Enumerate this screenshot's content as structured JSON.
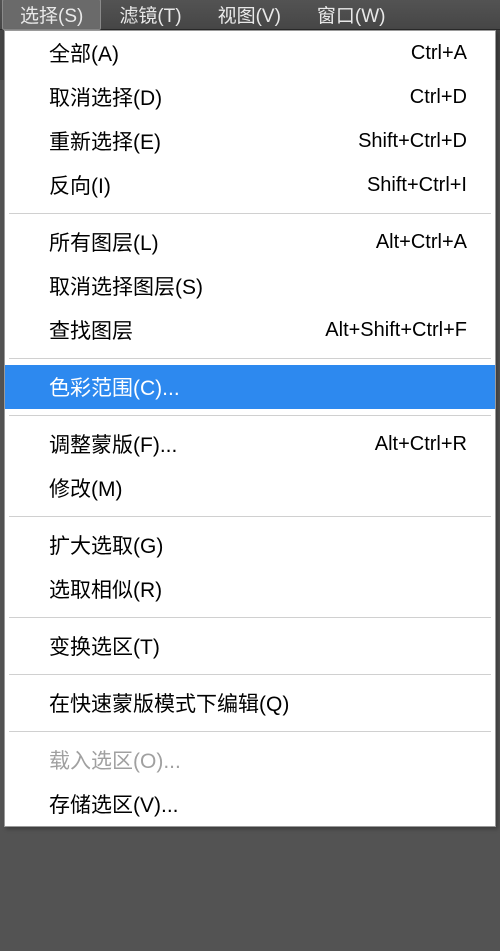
{
  "menubar": {
    "items": [
      {
        "label": "选择(S)",
        "active": true
      },
      {
        "label": "滤镜(T)",
        "active": false
      },
      {
        "label": "视图(V)",
        "active": false
      },
      {
        "label": "窗口(W)",
        "active": false
      }
    ]
  },
  "dropdown": {
    "groups": [
      [
        {
          "label": "全部(A)",
          "shortcut": "Ctrl+A",
          "disabled": false,
          "highlighted": false
        },
        {
          "label": "取消选择(D)",
          "shortcut": "Ctrl+D",
          "disabled": false,
          "highlighted": false
        },
        {
          "label": "重新选择(E)",
          "shortcut": "Shift+Ctrl+D",
          "disabled": false,
          "highlighted": false
        },
        {
          "label": "反向(I)",
          "shortcut": "Shift+Ctrl+I",
          "disabled": false,
          "highlighted": false
        }
      ],
      [
        {
          "label": "所有图层(L)",
          "shortcut": "Alt+Ctrl+A",
          "disabled": false,
          "highlighted": false
        },
        {
          "label": "取消选择图层(S)",
          "shortcut": "",
          "disabled": false,
          "highlighted": false
        },
        {
          "label": "查找图层",
          "shortcut": "Alt+Shift+Ctrl+F",
          "disabled": false,
          "highlighted": false
        }
      ],
      [
        {
          "label": "色彩范围(C)...",
          "shortcut": "",
          "disabled": false,
          "highlighted": true
        }
      ],
      [
        {
          "label": "调整蒙版(F)...",
          "shortcut": "Alt+Ctrl+R",
          "disabled": false,
          "highlighted": false
        },
        {
          "label": "修改(M)",
          "shortcut": "",
          "disabled": false,
          "highlighted": false
        }
      ],
      [
        {
          "label": "扩大选取(G)",
          "shortcut": "",
          "disabled": false,
          "highlighted": false
        },
        {
          "label": "选取相似(R)",
          "shortcut": "",
          "disabled": false,
          "highlighted": false
        }
      ],
      [
        {
          "label": "变换选区(T)",
          "shortcut": "",
          "disabled": false,
          "highlighted": false
        }
      ],
      [
        {
          "label": "在快速蒙版模式下编辑(Q)",
          "shortcut": "",
          "disabled": false,
          "highlighted": false
        }
      ],
      [
        {
          "label": "载入选区(O)...",
          "shortcut": "",
          "disabled": true,
          "highlighted": false
        },
        {
          "label": "存储选区(V)...",
          "shortcut": "",
          "disabled": false,
          "highlighted": false
        }
      ]
    ]
  }
}
